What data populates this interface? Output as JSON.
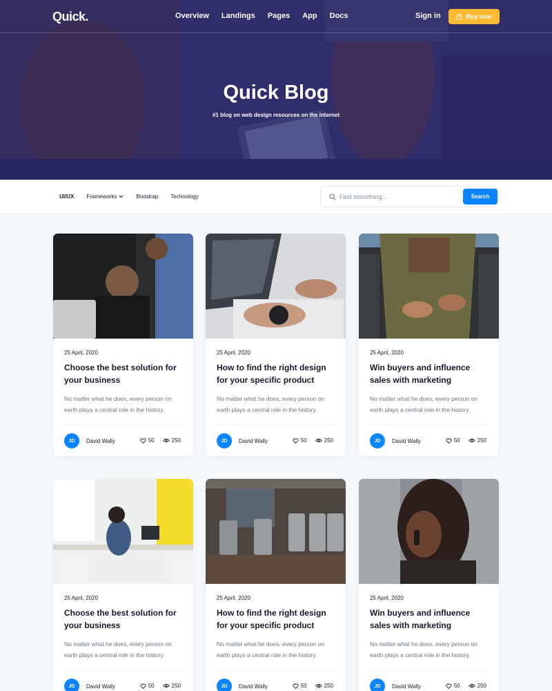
{
  "header": {
    "logo": "Quick.",
    "nav": [
      "Overview",
      "Landings",
      "Pages",
      "App",
      "Docs"
    ],
    "signin": "Sign in",
    "buy_label": "Buy now"
  },
  "hero": {
    "title": "Quick Blog",
    "subtitle": "#1 blog on web design resources on the internet"
  },
  "filters": {
    "items": [
      {
        "label": "UI/UX",
        "active": true
      },
      {
        "label": "Frameworks",
        "active": false
      },
      {
        "label": "Boostrap",
        "active": false
      },
      {
        "label": "Technology",
        "active": false
      }
    ]
  },
  "search": {
    "placeholder": "Find something...",
    "button": "Search"
  },
  "posts": [
    {
      "date": "25 April, 2020",
      "title": "Choose the best solution for your business",
      "excerpt": "No matter what he does, every person on earth plays a central role in the history.",
      "initials": "JD",
      "author": "David Wally",
      "likes": "50",
      "views": "250",
      "image": "office-laptop-men"
    },
    {
      "date": "25 April, 2020",
      "title": "How to find the right design for your specific product",
      "excerpt": "No matter what he does, every person on earth plays a central role in the history.",
      "initials": "JD",
      "author": "David Wally",
      "likes": "50",
      "views": "250",
      "image": "laptop-typing-watch"
    },
    {
      "date": "25 April, 2020",
      "title": "Win buyers and influence sales with marketing",
      "excerpt": "No matter what he does, every person on earth plays a central role in the history.",
      "initials": "JD",
      "author": "David Wally",
      "likes": "50",
      "views": "250",
      "image": "apron-hands"
    },
    {
      "date": "25 April, 2020",
      "title": "Choose the best solution for your business",
      "excerpt": "No matter what he does, every person on earth plays a central role in the history.",
      "initials": "JD",
      "author": "David Wally",
      "likes": "50",
      "views": "250",
      "image": "bright-office"
    },
    {
      "date": "25 April, 2020",
      "title": "How to find the right design for your specific product",
      "excerpt": "No matter what he does, every person on earth plays a central role in the history.",
      "initials": "JD",
      "author": "David Wally",
      "likes": "50",
      "views": "250",
      "image": "brewery-kegs"
    },
    {
      "date": "25 April, 2020",
      "title": "Win buyers and influence sales with marketing",
      "excerpt": "No matter what he does, every person on earth plays a central role in the history.",
      "initials": "JD",
      "author": "David Wally",
      "likes": "50",
      "views": "250",
      "image": "woman-phone"
    }
  ],
  "colors": {
    "accent": "#0a84ff",
    "buy": "#ffbb33",
    "hero_overlay": "#2a2a64"
  }
}
